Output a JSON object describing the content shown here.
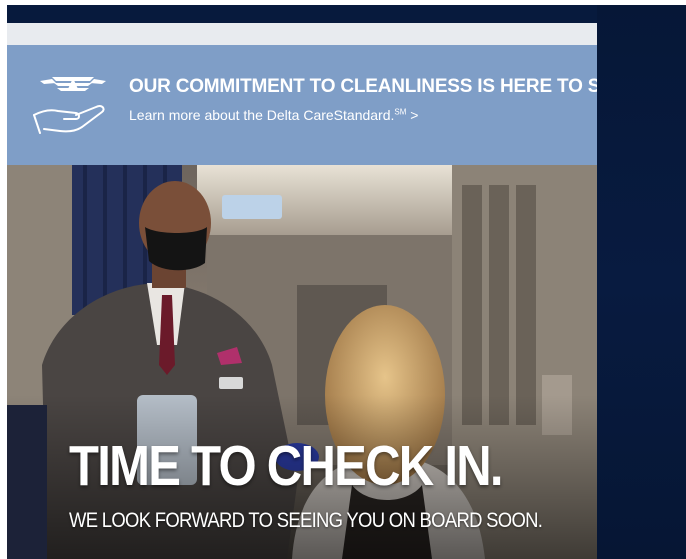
{
  "banner": {
    "headline": "OUR COMMITMENT TO CLEANLINESS IS HERE TO STAY.",
    "link_text": "Learn more about the Delta CareStandard.",
    "link_superscript": "SM",
    "link_arrow": " >",
    "icon": "hand-holding-delta-wings-icon"
  },
  "hero": {
    "headline": "TIME TO CHECK IN.",
    "subheadline": "WE LOOK FORWARD TO SEEING YOU ON BOARD SOON.",
    "image": "flight-attendant-greeting-passenger-photo"
  },
  "colors": {
    "banner_bg": "#7f9ec7",
    "frame_navy": "#071a3d",
    "text_white": "#ffffff"
  }
}
